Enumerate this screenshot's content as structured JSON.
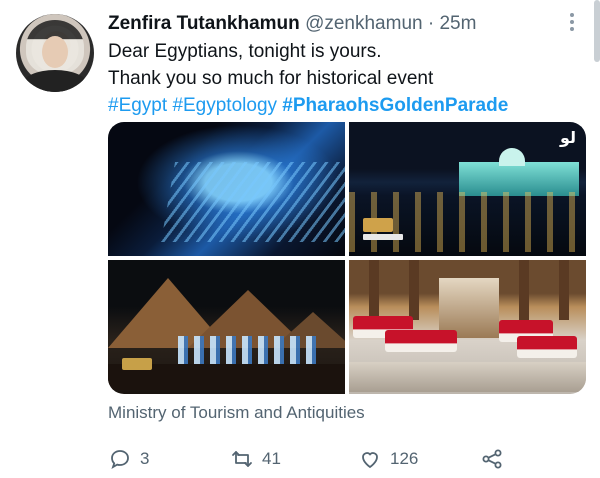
{
  "tweet": {
    "author_name": "Zenfira Tutankhamun",
    "handle": "@zenkhamun",
    "separator": "·",
    "time": "25m",
    "lines": [
      "Dear Egyptians, tonight is yours.",
      "Thank you so much for historical event"
    ],
    "hashtags": [
      "#Egypt",
      "#Egyptology",
      "#PharaohsGoldenParade"
    ],
    "source": "Ministry of Tourism and Antiquities",
    "media_logo_text": "لو"
  },
  "actions": {
    "replies": "3",
    "retweets": "41",
    "likes": "126"
  },
  "icons": {
    "more": "more-options-icon",
    "reply": "reply-icon",
    "retweet": "retweet-icon",
    "like": "like-icon",
    "share": "share-icon"
  },
  "colors": {
    "text": "#0f1419",
    "muted": "#536471",
    "link": "#1d9bf0"
  }
}
